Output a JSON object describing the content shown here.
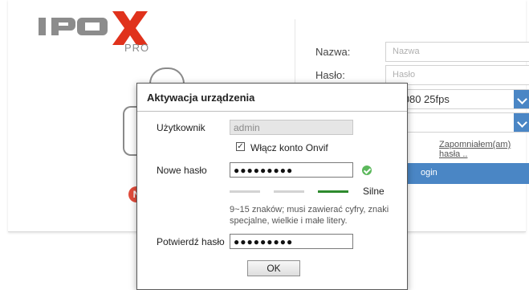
{
  "brand": {
    "logo_text": "IPOX",
    "logo_sub": "PRO"
  },
  "login": {
    "name_label": "Nazwa:",
    "name_placeholder": "Nazwa",
    "password_label": "Hasło:",
    "password_placeholder": "Hasło",
    "resolution_value": "x1080 25fps",
    "second_select_value": "i",
    "forgot_link": "Zapomniałem(am) hasła ..",
    "login_button": "ogin",
    "badge": "N"
  },
  "dialog": {
    "title": "Aktywacja urządzenia",
    "user_label": "Użytkownik",
    "user_value": "admin",
    "onvif_checkbox": "Włącz konto Onvif",
    "onvif_checked_mark": "✓",
    "new_password_label": "Nowe hasło",
    "new_password_value": "●●●●●●●●●",
    "strength_label": "Silne",
    "hint": "9~15 znaków; musi zawierać cyfry, znaki specjalne, wielkie i małe litery.",
    "confirm_label": "Potwierdź hasło",
    "confirm_value": "●●●●●●●●●",
    "ok_button": "OK"
  },
  "colors": {
    "accent": "#4a86c5",
    "logo_grey": "#8c8c8c",
    "logo_red": "#e0321c",
    "strength_strong": "#2e8b2e"
  }
}
